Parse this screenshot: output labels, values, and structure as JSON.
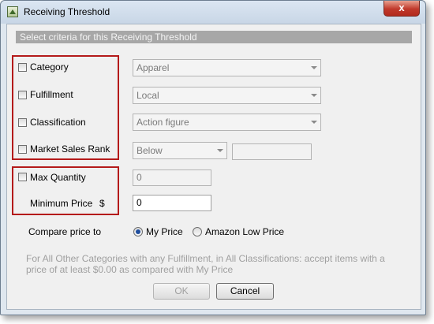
{
  "window": {
    "title": "Receiving Threshold",
    "close_symbol": "x"
  },
  "section_header": "Select criteria for this Receiving Threshold",
  "criteria": {
    "category": {
      "label": "Category",
      "value": "Apparel",
      "checked": false
    },
    "fulfillment": {
      "label": "Fulfillment",
      "value": "Local",
      "checked": false
    },
    "classification": {
      "label": "Classification",
      "value": "Action figure",
      "checked": false
    },
    "market_sales_rank": {
      "label": "Market Sales Rank",
      "operator": "Below",
      "value": "",
      "checked": false
    }
  },
  "quantity": {
    "label": "Max Quantity",
    "value": "0",
    "checked": false
  },
  "price": {
    "label": "Minimum Price",
    "currency": "$",
    "value": "0"
  },
  "compare": {
    "label": "Compare price to",
    "options": [
      {
        "label": "My Price",
        "selected": true
      },
      {
        "label": "Amazon Low Price",
        "selected": false
      }
    ]
  },
  "summary": "For All Other Categories with any Fulfillment, in All Classifications: accept items with a price of at least $0.00 as compared with My Price",
  "buttons": {
    "ok": "OK",
    "cancel": "Cancel"
  },
  "colors": {
    "highlight_border": "#b41a1a",
    "header_bg": "#a7a7a7",
    "radio_dot": "#1f4e9e"
  }
}
